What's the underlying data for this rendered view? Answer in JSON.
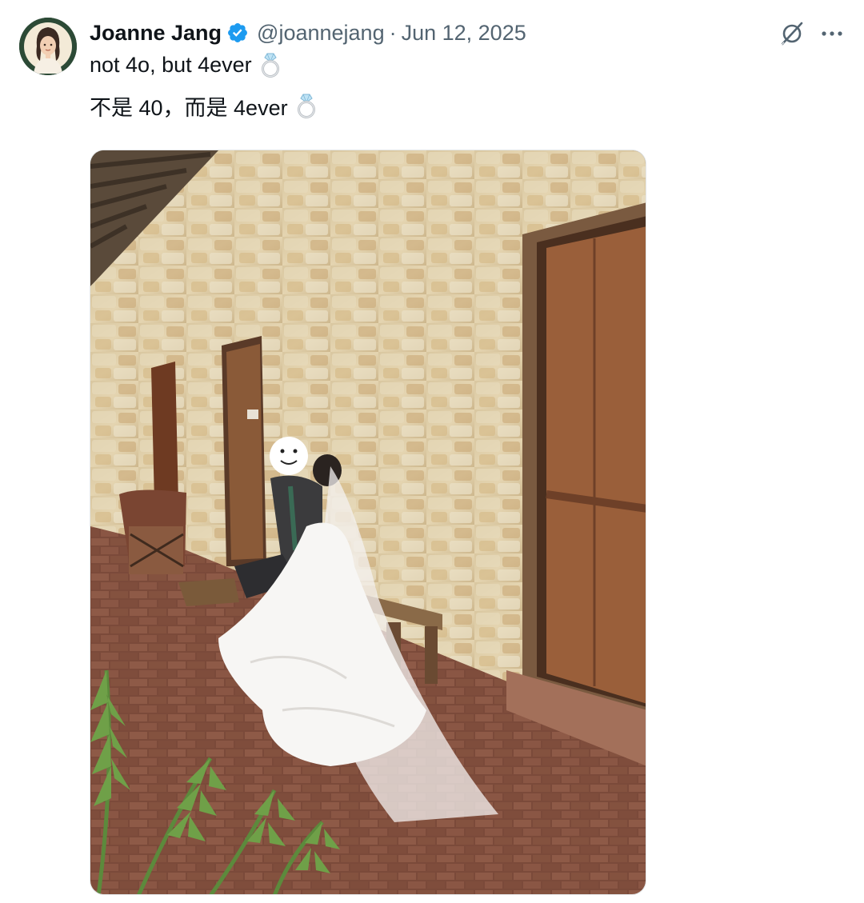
{
  "author": {
    "display_name": "Joanne Jang",
    "handle": "@joannejang",
    "separator": "·",
    "date": "Jun 12, 2025",
    "verified": true,
    "avatar_icon": "avatar-illustration",
    "verified_color": "#1d9bf0"
  },
  "tweet": {
    "line1": "not 4o, but 4ever",
    "line2": "不是 40，而是 4ever",
    "emoji": "ring-emoji"
  },
  "actions": {
    "grok_icon": "grok-icon",
    "more_icon": "more-icon"
  },
  "media": {
    "type": "photo",
    "icon": "wedding-photo"
  }
}
